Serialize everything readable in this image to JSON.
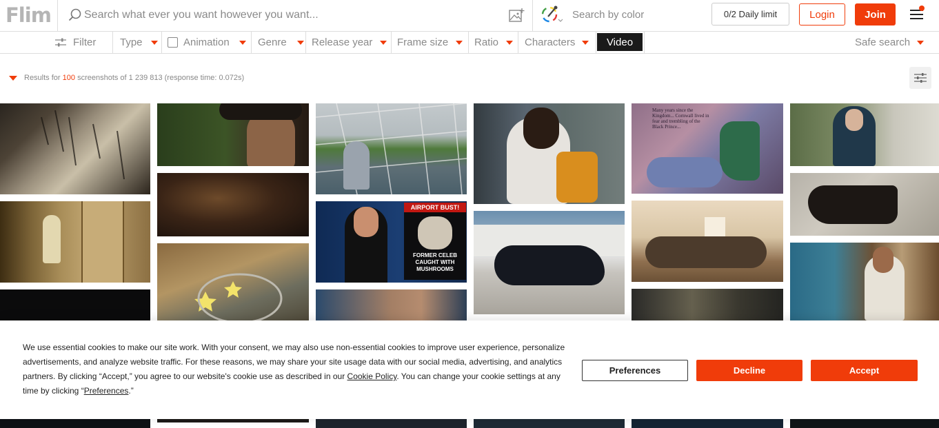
{
  "header": {
    "logo": "Flim",
    "search_placeholder": "Search what ever you want however you want...",
    "color_search": "Search by color",
    "daily_limit": "0/2 Daily limit",
    "login": "Login",
    "join": "Join"
  },
  "filters": {
    "filter": "Filter",
    "type": "Type",
    "animation": "Animation",
    "genre": "Genre",
    "release_year": "Release year",
    "frame_size": "Frame size",
    "ratio": "Ratio",
    "characters": "Characters",
    "video": "Video",
    "safe_search": "Safe search"
  },
  "results": {
    "prefix": "Results for",
    "count": "100",
    "suffix": "screenshots of 1 239 813 (response time: 0.072s)"
  },
  "colors": {
    "accent": "#f03c0a",
    "dark": "#1a1a1a"
  },
  "cookie": {
    "text_1": "We use essential cookies to make our site work. With your consent, we may also use non-essential cookies to improve user experience, personalize advertisements, and analyze website traffic. For these reasons, we may share your site usage data with our social media, advertising, and analytics partners. By clicking “Accept,” you agree to our website's cookie use as described in our ",
    "link_policy": "Cookie Policy",
    "text_2": ". You can change your cookie settings at any time by clicking “",
    "link_prefs": "Preferences",
    "text_3": ".”",
    "preferences_btn": "Preferences",
    "decline_btn": "Decline",
    "accept_btn": "Accept"
  },
  "thumbnail_texts": {
    "airport": "AIRPORT BUST!",
    "headline": "FORMER CELEB CAUGHT WITH MUSHROOMS",
    "book": "Many years since the Kingdom... Cornwall lived in fear and trembling of the Black Prince..."
  }
}
